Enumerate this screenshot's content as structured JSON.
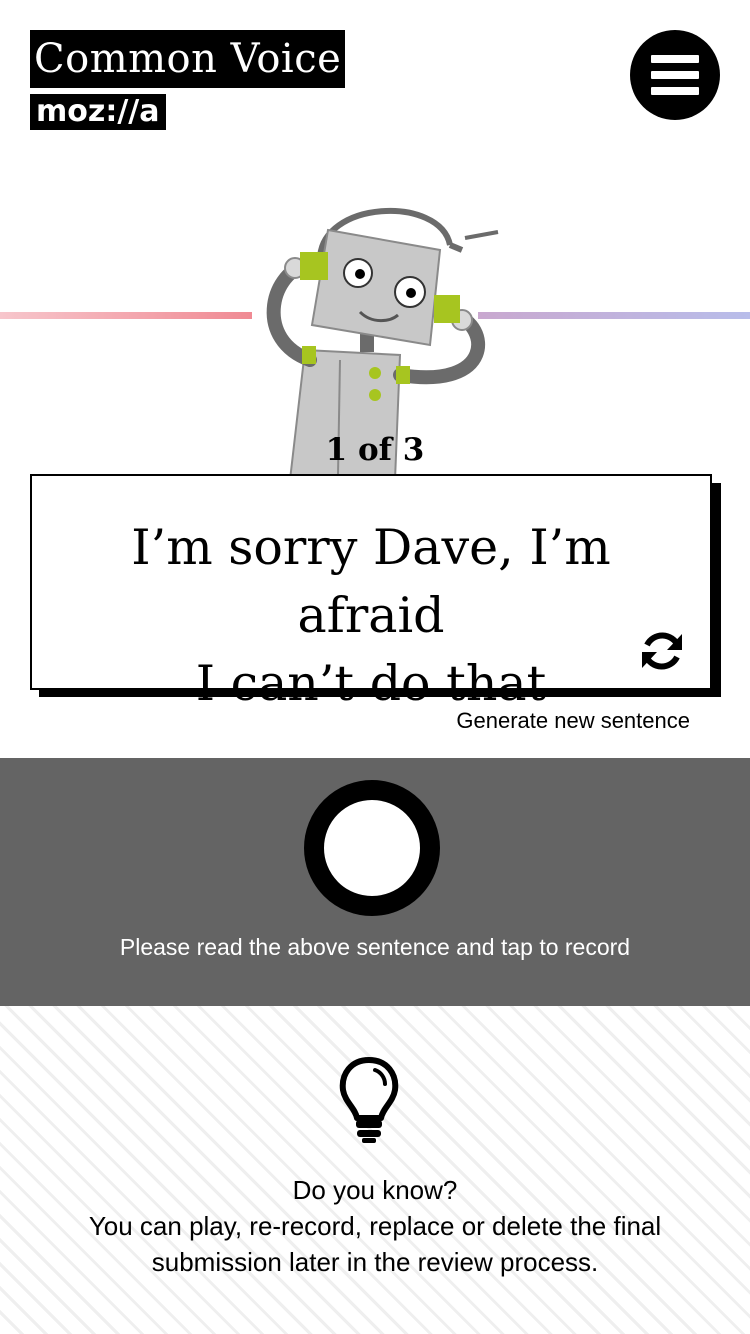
{
  "header": {
    "title": "Common Voice",
    "brand": "moz://a",
    "menu_icon": "hamburger-menu-icon"
  },
  "prompt": {
    "counter": "1 of 3",
    "sentence_line1": "I’m sorry Dave, I’m afraid",
    "sentence_line2": "I can’t do that",
    "refresh_icon": "refresh-icon",
    "generate_label": "Generate new sentence"
  },
  "record": {
    "hint": "Please read the above sentence and tap to record",
    "button_icon": "record-circle-icon"
  },
  "tip": {
    "icon": "lightbulb-icon",
    "heading": "Do you know?",
    "body_line1": "You can play, re-record, replace or delete the final",
    "body_line2": "submission later in the review process."
  },
  "colors": {
    "panel": "#646464",
    "accent_green": "#a7c520",
    "line_left": "#f08a93",
    "line_right": "#b8bdea"
  }
}
